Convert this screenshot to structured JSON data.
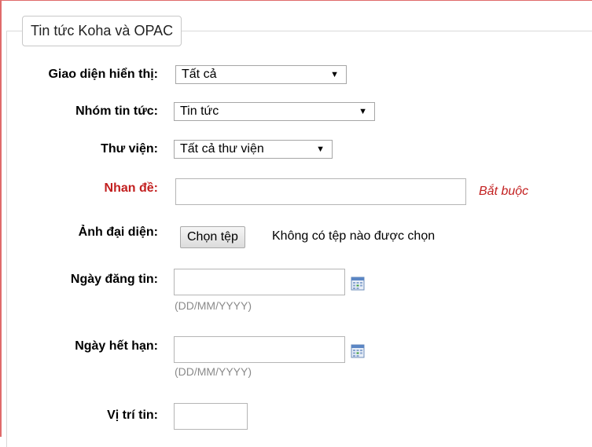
{
  "legend": "Tin tức Koha và OPAC",
  "fields": {
    "display": {
      "label": "Giao diện hiển thị:",
      "value": "Tất cả"
    },
    "news_group": {
      "label": "Nhóm tin tức:",
      "value": "Tin tức"
    },
    "library": {
      "label": "Thư viện:",
      "value": "Tất cả thư viện"
    },
    "title": {
      "label": "Nhan đề:",
      "value": "",
      "required_text": "Bắt buộc"
    },
    "image": {
      "label": "Ảnh đại diện:",
      "button": "Chọn tệp",
      "status": "Không có tệp nào được chọn"
    },
    "publish_date": {
      "label": "Ngày đăng tin:",
      "value": "",
      "hint": "(DD/MM/YYYY)"
    },
    "expiry_date": {
      "label": "Ngày hết hạn:",
      "value": "",
      "hint": "(DD/MM/YYYY)"
    },
    "position": {
      "label": "Vị trí tin:",
      "value": ""
    }
  },
  "icons": {
    "calendar": "calendar-icon",
    "dropdown": "dropdown-arrow-icon"
  },
  "colors": {
    "required": "#c21f1f",
    "frame": "#e06b6b",
    "hint": "#8a8a8a"
  }
}
